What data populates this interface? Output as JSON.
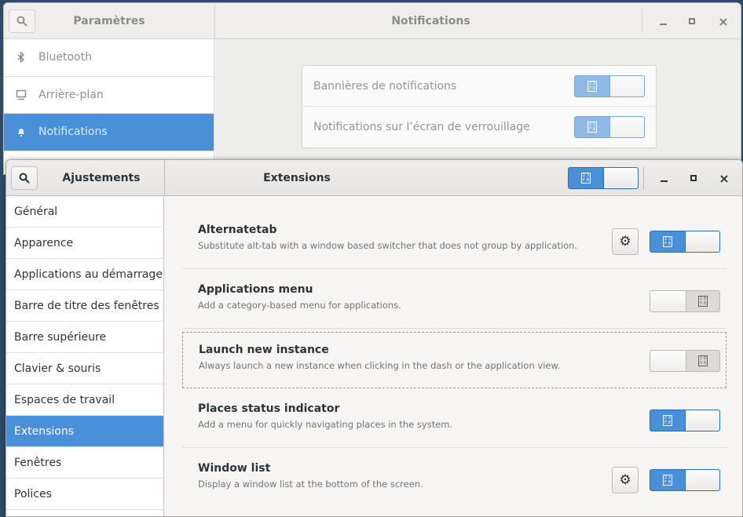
{
  "background_window": {
    "app_title": "Paramètres",
    "title": "Notifications",
    "controls": {
      "minimize": "–",
      "maximize": "▫",
      "close": "×"
    },
    "sidebar": [
      {
        "label": "Bluetooth",
        "icon": "bluetooth-icon",
        "selected": false
      },
      {
        "label": "Arrière-plan",
        "icon": "background-icon",
        "selected": false
      },
      {
        "label": "Notifications",
        "icon": "bell-icon",
        "selected": true
      }
    ],
    "settings": [
      {
        "label": "Bannières de notifications",
        "state": "on"
      },
      {
        "label": "Notifications sur l’écran de verrouillage",
        "state": "on"
      }
    ]
  },
  "foreground_window": {
    "app_title": "Ajustements",
    "title": "Extensions",
    "global_switch": "on",
    "controls": {
      "minimize": "–",
      "maximize": "▫",
      "close": "×"
    },
    "sidebar": [
      {
        "label": "Général",
        "selected": false
      },
      {
        "label": "Apparence",
        "selected": false
      },
      {
        "label": "Applications au démarrage",
        "selected": false
      },
      {
        "label": "Barre de titre des fenêtres",
        "selected": false
      },
      {
        "label": "Barre supérieure",
        "selected": false
      },
      {
        "label": "Clavier & souris",
        "selected": false
      },
      {
        "label": "Espaces de travail",
        "selected": false
      },
      {
        "label": "Extensions",
        "selected": true
      },
      {
        "label": "Fenêtres",
        "selected": false
      },
      {
        "label": "Polices",
        "selected": false
      }
    ],
    "extensions": [
      {
        "name": "Alternatetab",
        "description": "Substitute alt-tab with a window based switcher that does not group by application.",
        "has_settings": true,
        "state": "on"
      },
      {
        "name": "Applications menu",
        "description": "Add a category-based menu for applications.",
        "has_settings": false,
        "state": "off"
      },
      {
        "name": "Launch new instance",
        "description": "Always launch a new instance when clicking in the dash or the application view.",
        "has_settings": false,
        "state": "off"
      },
      {
        "name": "Places status indicator",
        "description": "Add a menu for quickly navigating places in the system.",
        "has_settings": false,
        "state": "on"
      },
      {
        "name": "Window list",
        "description": "Display a window list at the bottom of the screen.",
        "has_settings": true,
        "state": "on"
      }
    ]
  },
  "colors": {
    "accent": "#4a90d9",
    "desktop": "#2f4a66"
  }
}
